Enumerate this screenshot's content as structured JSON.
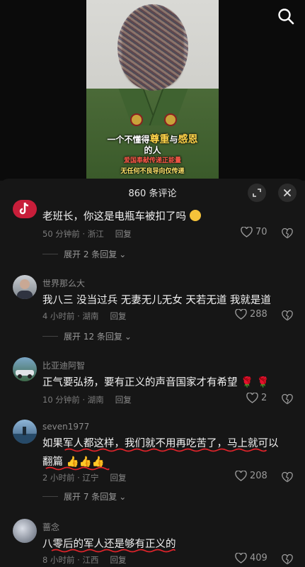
{
  "video": {
    "caption_line1_a": "一个不懂得",
    "caption_line1_b": "尊重",
    "caption_line1_c": "与",
    "caption_line1_d": "感恩",
    "caption_line2": "的人",
    "caption_line3": "爱国奉献传递正能量",
    "caption_line4": "无任何不良导向仅传递"
  },
  "header": {
    "title": "860 条评论",
    "expand_icon": "expand-icon",
    "close_icon": "close-icon"
  },
  "comments": [
    {
      "username": "",
      "text": "老班长，你这是电瓶车被扣了吗",
      "time": "50 分钟前 · 浙江",
      "reply": "回复",
      "likes": "70",
      "expand": "展开 2 条回复"
    },
    {
      "username": "世界那么大",
      "text": "我八三 没当过兵  无妻无儿无女  天若无道  我就是道",
      "time": "4 小时前 · 湖南",
      "reply": "回复",
      "likes": "288",
      "expand": "展开 12 条回复"
    },
    {
      "username": "比亚迪阿智",
      "text": "正气要弘扬，要有正义的声音国家才有希望",
      "time": "10 分钟前 · 湖南",
      "reply": "回复",
      "likes": "2"
    },
    {
      "username": "seven1977",
      "text_line1": "如果军人都这样，我们就不用再吃苦了，马上就可以",
      "text_line2": "翻篇",
      "time": "2 小时前 · 辽宁",
      "reply": "回复",
      "likes": "208",
      "expand": "展开 7 条回复"
    },
    {
      "username": "蔷念",
      "text": "八零后的军人还是够有正义的",
      "time": "8 小时前 · 江西",
      "reply": "回复",
      "likes": "409"
    }
  ],
  "colors": {
    "background": "#161616",
    "underline": "#e0242b",
    "gold": "#ffd54a"
  }
}
